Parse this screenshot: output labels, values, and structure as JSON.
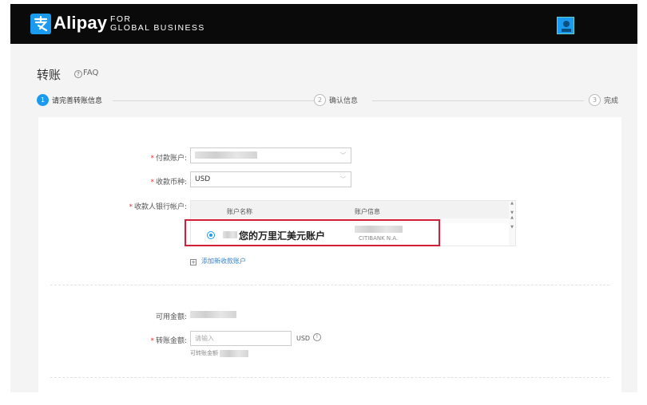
{
  "header": {
    "brand": "Alipay",
    "tagline_line1": "FOR",
    "tagline_line2": "GLOBAL BUSINESS"
  },
  "page": {
    "title": "转账",
    "faq": "FAQ"
  },
  "steps": [
    {
      "num": "1",
      "label": "请完善转账信息",
      "active": true
    },
    {
      "num": "2",
      "label": "确认信息",
      "active": false
    },
    {
      "num": "3",
      "label": "完成",
      "active": false
    }
  ],
  "form": {
    "payment_account_label": "付款账户:",
    "currency_label": "收款币种:",
    "currency_value": "USD",
    "payee_account_label": "收款人银行帐户:",
    "table_headers": [
      "账户名称",
      "账户信息"
    ],
    "account_name": "您的万里汇美元账户",
    "bank_name": "CITIBANK N.A.",
    "add_account": "添加新收款账户",
    "available_label": "可用金额:",
    "transfer_label": "转账金额:",
    "transfer_placeholder": "请输入",
    "transfer_currency": "USD",
    "hint": "可转账金额"
  },
  "colors": {
    "accent": "#1a9bef",
    "highlight": "#d51f3a",
    "header_bg": "#0a0a0a"
  }
}
